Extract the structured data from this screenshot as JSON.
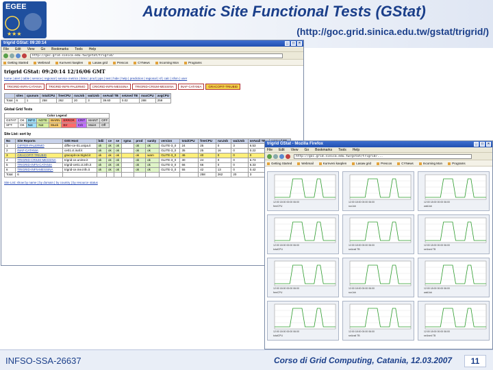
{
  "slide": {
    "title": "Automatic Site Functional Tests (GStat)",
    "url": "(http://goc.grid.sinica.edu.tw/gstat/trigrid/)",
    "logo_text": "EGEE",
    "footer_left": "INFSO-SSA-26637",
    "footer_center": "Corso di Grid Computing, Catania, 12.03.2007",
    "page_number": "11"
  },
  "main_window": {
    "title": "trigrid GStat: 09:20:14",
    "menu": [
      "File",
      "Edit",
      "View",
      "Go",
      "Bookmarks",
      "Tools",
      "Help"
    ],
    "url": "http://goc.grid.sinica.edu.tw/gstat/trigrid/",
    "bookmarks": [
      "Getting Started",
      "Webmail",
      "Kurnveni kasplen",
      "Lasaw grid",
      "Prescos",
      "CYNews",
      "Incoming Mon",
      "Programs"
    ],
    "page_title": "trigrid GStat: 09:20:14 12/16/06 GMT",
    "nav_links": "home | alert | table | service | regional | service metrics | links | prod | pps | test | hide | help | prediction | regional | sf | calc | sfsm | user",
    "site_tabs": [
      "TRIGRID-INFN-CATANIA",
      "TRIGRID-INFN-PALERMO",
      "CRIGRID-INFN-MESSINA",
      "TRIGRID-CRIUM-MESSINA",
      "INAF-CATANIA",
      "GRACOPIT-TRIUBID"
    ],
    "highlight_tab": 5,
    "summary": {
      "headers": [
        "sites",
        "cpunum",
        "totalCPU",
        "freeCPU",
        "runJob",
        "waitJob",
        "seAvail TB",
        "seUsed TB",
        "maxCPU",
        "avgCPU"
      ],
      "row": [
        "Total",
        "6",
        "1",
        "258",
        "262",
        "20",
        "3",
        "39.60",
        "0.02",
        "288",
        "259"
      ]
    },
    "global_title": "Global Grid Tests",
    "legend_title": "Color Legend",
    "legend_rows": [
      [
        "GSTAT:",
        "OK",
        "INFO",
        "NOTE",
        "WARN",
        "ERROR",
        "CRIT",
        "MAINT",
        "OFF"
      ],
      [
        "SFT:",
        "OK",
        "Not",
        "Not",
        "Stuck",
        "Err",
        "Crit",
        "Maint",
        "Off"
      ]
    ],
    "sites_title": "Site List: sort by",
    "sites_headers": [
      "No",
      "Site Reports",
      "GIIS Host",
      "bdii",
      "ce",
      "se",
      "rgma",
      "prod",
      "sanity",
      "version",
      "totalCPU",
      "freeCPU",
      "runJob",
      "waitJob",
      "seAvail TB",
      "seUsed TB"
    ],
    "sites": [
      [
        "1",
        "DIFFER-PALERMO",
        "differ-ce-01.unipa.it",
        "ok",
        "ok",
        "ok",
        "",
        "ok",
        "ok",
        "GLITE-3_0",
        "24",
        "25",
        "0",
        "3",
        "6.53",
        "0"
      ],
      [
        "2",
        "INAF-CATANIA",
        "ce01.ct.inaf.it",
        "ok",
        "ok",
        "ok",
        "",
        "ok",
        "ok",
        "GLITE-3_0",
        "35",
        "25",
        "16",
        "0",
        "0.22",
        "0"
      ],
      [
        "3",
        "GRACOPIT-TRIUBID",
        "gracopit-ce.trigrid.it",
        "ok",
        "ok",
        "ok",
        "",
        "ok",
        "warn",
        "GLITE-3_0",
        "46",
        "40",
        "0",
        "0",
        "0",
        "0"
      ],
      [
        "4",
        "TRIGRID-CRIUM-MESSINA",
        "trigrid-ce.unime.it",
        "ok",
        "ok",
        "ok",
        "",
        "ok",
        "ok",
        "GLITE-3_0",
        "30",
        "24",
        "0",
        "0",
        "6.73",
        "0"
      ],
      [
        "5",
        "TRIGRID-INFN-CATANIA",
        "trigrid-ce01.ct.infn.it",
        "ok",
        "ok",
        "ok",
        "",
        "ok",
        "ok",
        "GLITE-3_0",
        "66",
        "66",
        "0",
        "0",
        "6.33",
        "0"
      ],
      [
        "6",
        "TRIGRID-INFN-MESSINA",
        "trigrid-ce.me.infn.it",
        "ok",
        "ok",
        "ok",
        "",
        "ok",
        "ok",
        "GLITE-3_0",
        "55",
        "42",
        "13",
        "0",
        "0.42",
        "0"
      ]
    ],
    "totals_label": "Total",
    "totals": [
      "6",
      "",
      "",
      "",
      "",
      "",
      "",
      "",
      "",
      "",
      "258",
      "262",
      "20",
      "3",
      "39.60",
      "0.02"
    ],
    "site_list_links": "Site List: show by name | by domain | by country | by resource status"
  },
  "graph_window": {
    "title": "trigrid GStat - Mozilla Firefox",
    "menu": [
      "File",
      "Edit",
      "View",
      "Go",
      "Bookmarks",
      "Tools",
      "Help"
    ],
    "url": "http://goc.grid.sinica.edu.tw/gstat/trigrid/...",
    "bookmarks": [
      "Getting Started",
      "Webmail",
      "Kurnveni kasplen",
      "Lasaw grid",
      "Prescos",
      "CYNews",
      "Incoming Mon",
      "Programs"
    ],
    "x_ticks": "12:00 18:00 00:00 06:00",
    "graphs": [
      {
        "label": "freeCPU",
        "peak": 12
      },
      {
        "label": "runJob",
        "peak": 4
      },
      {
        "label": "waitJob",
        "peak": 8
      },
      {
        "label": "totalCPU",
        "peak": 20
      },
      {
        "label": "seAvail TB",
        "peak": 6
      },
      {
        "label": "seUsed TB",
        "peak": 3
      },
      {
        "label": "freeCPU",
        "peak": 30
      },
      {
        "label": "runJob",
        "peak": 14
      },
      {
        "label": "waitJob",
        "peak": 10
      },
      {
        "label": "totalCPU",
        "peak": 8
      },
      {
        "label": "seAvail TB",
        "peak": 16
      },
      {
        "label": "seUsed TB",
        "peak": 5
      }
    ]
  },
  "colors": {
    "brand": "#1b3f8a",
    "title_bar": "#204fb0",
    "highlight": "#f2d44a"
  }
}
